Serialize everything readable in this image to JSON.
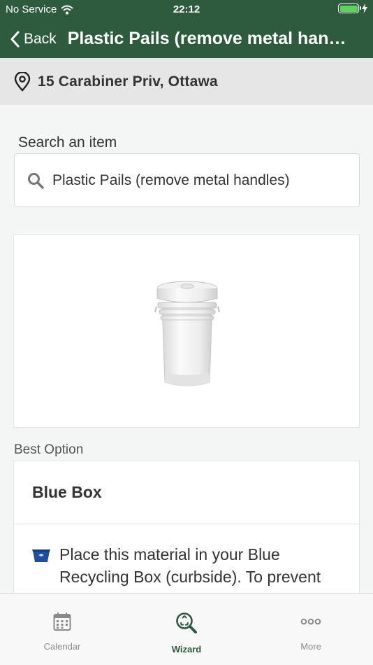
{
  "status_bar": {
    "carrier": "No Service",
    "time": "22:12",
    "battery_level": 1.0,
    "charging": true
  },
  "nav": {
    "back_label": "Back",
    "title": "Plastic Pails (remove metal handles)"
  },
  "address": {
    "text": "15 Carabiner Priv, Ottawa",
    "icon": "location-pin-icon"
  },
  "search": {
    "label": "Search an item",
    "value": "Plastic Pails (remove metal handles)",
    "icon": "search-icon"
  },
  "item_image": {
    "icon": "plastic-pail-image"
  },
  "best_option": {
    "section_label": "Best Option",
    "title": "Blue Box",
    "description": "Place this material in your Blue Recycling Box (curbside). To prevent materials from blowing around, place",
    "icon": "blue-box-icon"
  },
  "tabs": [
    {
      "label": "Calendar",
      "icon": "calendar-icon",
      "active": false
    },
    {
      "label": "Wizard",
      "icon": "recycle-search-icon",
      "active": true
    },
    {
      "label": "More",
      "icon": "more-dots-icon",
      "active": false
    }
  ],
  "colors": {
    "brand_green": "#2e5a3e",
    "background": "#f3f6f4",
    "blue_box": "#1f4e9c"
  }
}
